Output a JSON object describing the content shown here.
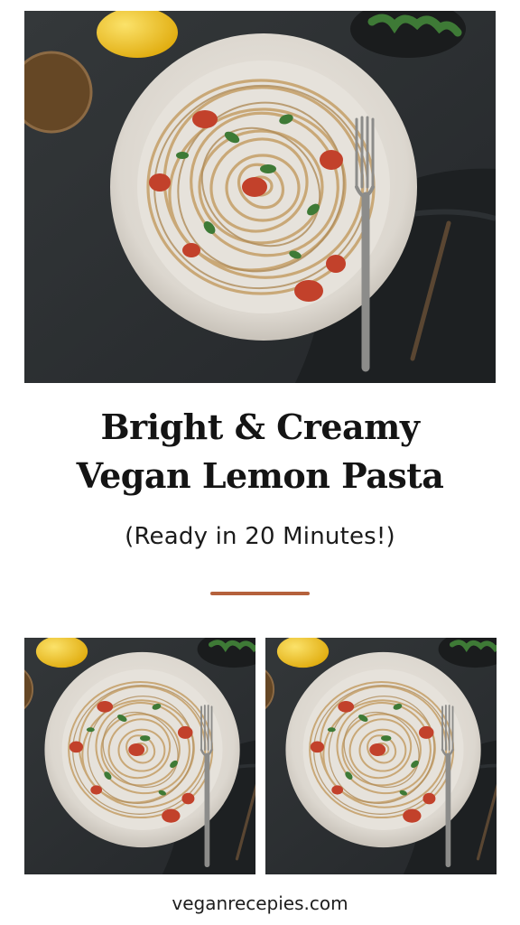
{
  "title": {
    "line1": "Bright & Creamy",
    "line2": "Vegan Lemon Pasta"
  },
  "subtitle": "(Ready in 20 Minutes!)",
  "footer": {
    "website": "veganrecepies.com"
  },
  "colors": {
    "background": "#ffffff",
    "accent_divider": "#b5613c",
    "table_surface": "#2b2e30",
    "plate": "#e7e3dc",
    "pasta": "#c9a877",
    "tomato": "#c2412b",
    "lemon": "#f0c419",
    "herb": "#3e7a36"
  },
  "images": {
    "hero": "lemon-pasta-photo",
    "thumbnails": [
      "lemon-pasta-photo",
      "lemon-pasta-photo"
    ]
  }
}
